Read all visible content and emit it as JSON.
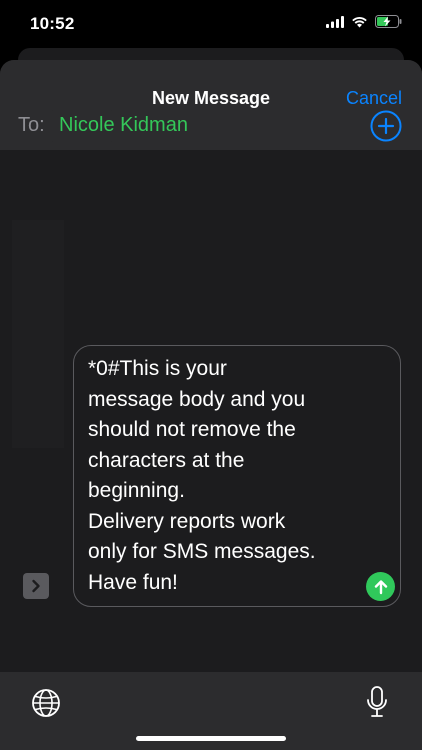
{
  "status_bar": {
    "time": "10:52"
  },
  "nav": {
    "title": "New Message",
    "cancel_label": "Cancel"
  },
  "recipient": {
    "to_label": "To:",
    "name": "Nicole Kidman"
  },
  "compose": {
    "message": "*0#This is your\nmessage body and you\nshould not remove the\ncharacters at the\nbeginning.\nDelivery reports work\nonly for SMS messages.\nHave fun!"
  },
  "icons": {
    "signal": "cellular-signal-icon",
    "wifi": "wifi-icon",
    "battery": "battery-charging-icon",
    "add": "plus-circle-icon",
    "apps": "chevron-right-icon",
    "send": "arrow-up-icon",
    "globe": "globe-icon",
    "mic": "microphone-icon"
  },
  "colors": {
    "accent": "#0a84ff",
    "recipient": "#34c759",
    "send": "#30c85b",
    "battery": "#34c759"
  }
}
